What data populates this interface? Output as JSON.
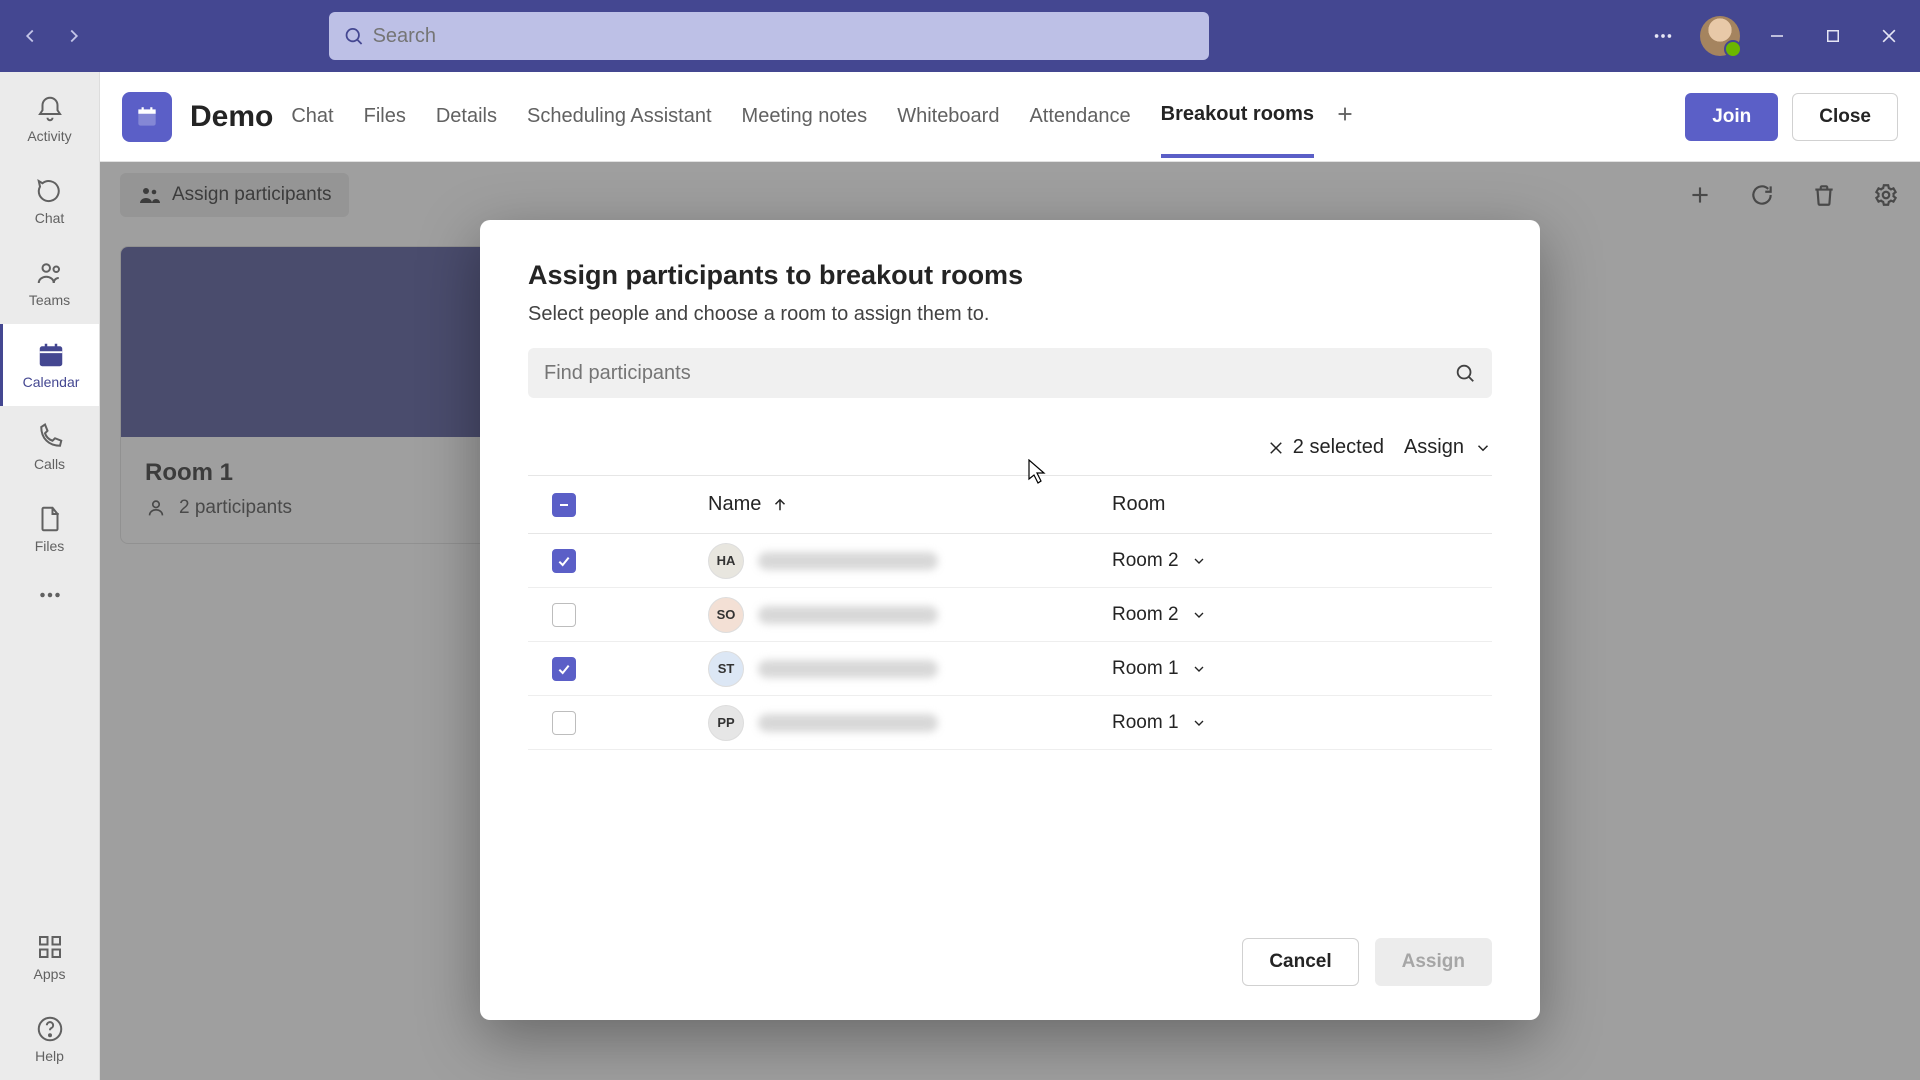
{
  "titlebar": {
    "search_placeholder": "Search"
  },
  "rail": {
    "items": [
      {
        "label": "Activity"
      },
      {
        "label": "Chat"
      },
      {
        "label": "Teams"
      },
      {
        "label": "Calendar"
      },
      {
        "label": "Calls"
      },
      {
        "label": "Files"
      }
    ],
    "apps_label": "Apps",
    "help_label": "Help"
  },
  "cmdbar": {
    "meeting_title": "Demo",
    "tabs": [
      "Chat",
      "Files",
      "Details",
      "Scheduling Assistant",
      "Meeting notes",
      "Whiteboard",
      "Attendance",
      "Breakout rooms"
    ],
    "active_tab_index": 7,
    "join_label": "Join",
    "close_label": "Close"
  },
  "content": {
    "assign_participants_label": "Assign participants",
    "room_name": "Room 1",
    "participant_count_label": "2 participants"
  },
  "modal": {
    "title": "Assign participants to breakout rooms",
    "subtitle": "Select people and choose a room to assign them to.",
    "find_placeholder": "Find participants",
    "selected_text": "2 selected",
    "assign_dd_label": "Assign",
    "col_name": "Name",
    "col_room": "Room",
    "rows": [
      {
        "initials": "HA",
        "room": "Room 2",
        "checked": true,
        "bg": "#e8e6df"
      },
      {
        "initials": "SO",
        "room": "Room 2",
        "checked": false,
        "bg": "#f3e0d5"
      },
      {
        "initials": "ST",
        "room": "Room 1",
        "checked": true,
        "bg": "#dce7f5"
      },
      {
        "initials": "PP",
        "room": "Room 1",
        "checked": false,
        "bg": "#e6e6e6"
      }
    ],
    "cancel_label": "Cancel",
    "assign_label": "Assign"
  }
}
